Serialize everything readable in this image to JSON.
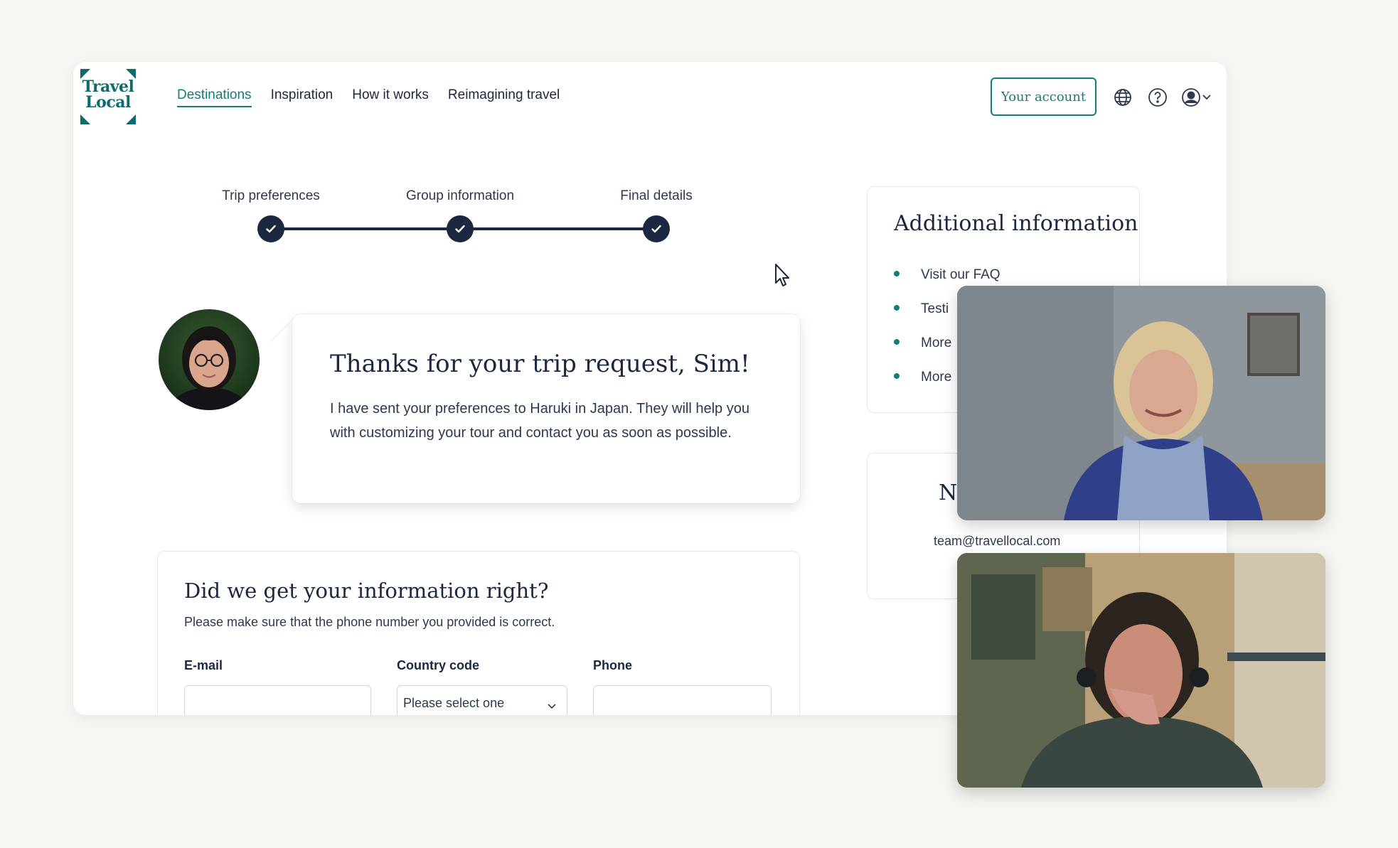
{
  "header": {
    "logo_line1": "Travel",
    "logo_line2": "Local",
    "nav": [
      {
        "label": "Destinations",
        "active": true
      },
      {
        "label": "Inspiration",
        "active": false
      },
      {
        "label": "How it works",
        "active": false
      },
      {
        "label": "Reimagining travel",
        "active": false
      }
    ],
    "account_label": "Your account",
    "icons": [
      "globe-icon",
      "help-icon",
      "user-icon",
      "chevron-down-icon"
    ]
  },
  "stepper": {
    "steps": [
      {
        "label": "Trip preferences",
        "done": true
      },
      {
        "label": "Group information",
        "done": true
      },
      {
        "label": "Final details",
        "done": true
      }
    ]
  },
  "message": {
    "title": "Thanks for your trip request, Sim!",
    "body": "I have sent your preferences to Haruki in Japan. They will help you with customizing your tour and contact you as soon as possible."
  },
  "form": {
    "title": "Did we get your information right?",
    "subtitle": "Please make sure that the phone number you provided is correct.",
    "email_label": "E-mail",
    "email_value": "",
    "country_label": "Country code",
    "country_placeholder": "Please select one",
    "phone_label": "Phone",
    "phone_value": ""
  },
  "sidebar": {
    "additional": {
      "title": "Additional information",
      "items": [
        "Visit our FAQ",
        "Testi",
        "More",
        "More"
      ]
    },
    "contact": {
      "title": "Ne",
      "email": "team@travellocal.com"
    }
  },
  "colors": {
    "accent": "#137d7a",
    "navy": "#1c2740",
    "background": "#f5f5f1"
  }
}
